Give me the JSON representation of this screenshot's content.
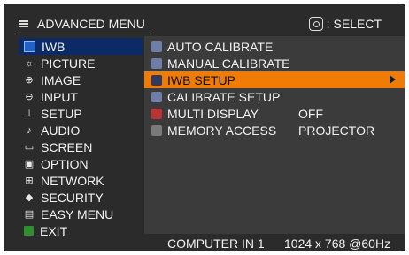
{
  "header": {
    "title": "ADVANCED MENU",
    "select_hint": "SELECT",
    "menu_icon": "menu-icon",
    "select_icon": "select-pad-icon"
  },
  "sidebar": {
    "items": [
      {
        "label": "IWB",
        "icon": "iwb-icon",
        "active": true
      },
      {
        "label": "PICTURE",
        "icon": "brightness-icon",
        "active": false
      },
      {
        "label": "IMAGE",
        "icon": "image-icon",
        "active": false
      },
      {
        "label": "INPUT",
        "icon": "input-icon",
        "active": false
      },
      {
        "label": "SETUP",
        "icon": "setup-icon",
        "active": false
      },
      {
        "label": "AUDIO",
        "icon": "audio-icon",
        "active": false
      },
      {
        "label": "SCREEN",
        "icon": "screen-icon",
        "active": false
      },
      {
        "label": "OPTION",
        "icon": "option-icon",
        "active": false
      },
      {
        "label": "NETWORK",
        "icon": "network-icon",
        "active": false
      },
      {
        "label": "SECURITY",
        "icon": "security-icon",
        "active": false
      },
      {
        "label": "EASY MENU",
        "icon": "easy-menu-icon",
        "active": false
      },
      {
        "label": "EXIT",
        "icon": "exit-icon",
        "active": false
      }
    ]
  },
  "main": {
    "rows": [
      {
        "label": "AUTO CALIBRATE",
        "value": "",
        "icon": "auto-calibrate-icon",
        "selected": false
      },
      {
        "label": "MANUAL CALIBRATE",
        "value": "",
        "icon": "manual-calibrate-icon",
        "selected": false
      },
      {
        "label": "IWB SETUP",
        "value": "",
        "icon": "iwb-setup-icon",
        "selected": true
      },
      {
        "label": "CALIBRATE SETUP",
        "value": "",
        "icon": "calibrate-setup-icon",
        "selected": false
      },
      {
        "label": "MULTI DISPLAY",
        "value": "OFF",
        "icon": "multi-display-icon",
        "selected": false
      },
      {
        "label": "MEMORY ACCESS",
        "value": "PROJECTOR",
        "icon": "memory-access-icon",
        "selected": false
      }
    ]
  },
  "status": {
    "input": "COMPUTER IN 1",
    "resolution": "1024 x 768 @60Hz"
  },
  "colors": {
    "background": "#2b2b2b",
    "panel": "#3b3b3b",
    "selected_row": "#f07b05",
    "active_sidebar": "#0b2a66",
    "text": "#f2f2f2"
  }
}
